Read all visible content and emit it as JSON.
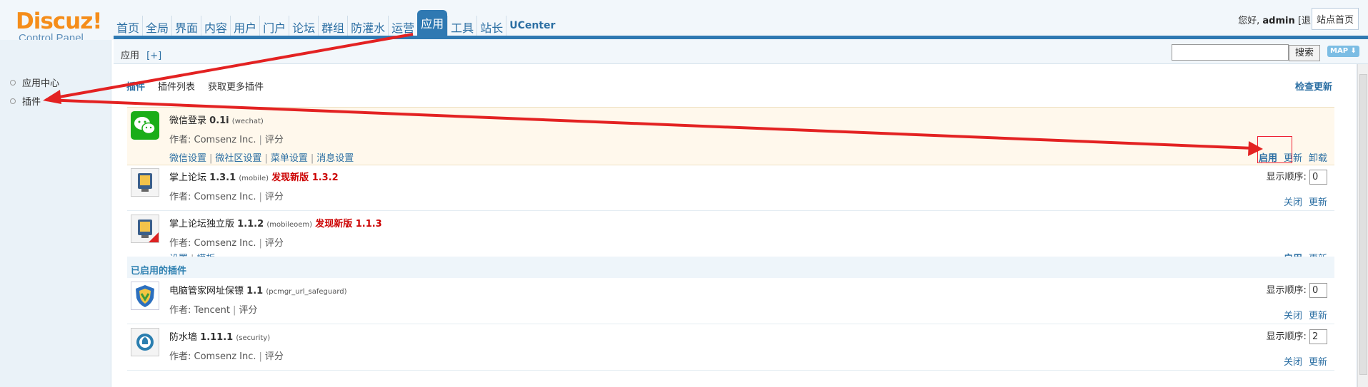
{
  "header": {
    "logo_brand": "Discuz!",
    "logo_sub": "Control Panel",
    "nav": [
      "首页",
      "全局",
      "界面",
      "内容",
      "用户",
      "门户",
      "论坛",
      "群组",
      "防灌水",
      "运营",
      "应用",
      "工具",
      "站长",
      "UCenter"
    ],
    "active_nav": "应用",
    "greeting_prefix": "您好,",
    "user": "admin",
    "logout": "[退出]",
    "site_home": "站点首页"
  },
  "sidebar": {
    "items": [
      {
        "label": "应用中心"
      },
      {
        "label": "插件"
      }
    ]
  },
  "subbar": {
    "crumb": "应用",
    "add": "[+]",
    "search_button": "搜索",
    "map_button": "MAP ⬇"
  },
  "tabs": {
    "items": [
      "插件",
      "插件列表",
      "获取更多插件"
    ],
    "check_update": "检查更新"
  },
  "plugins": [
    {
      "name": "微信登录",
      "version": "0.1i",
      "id": "(wechat)",
      "new_version": "",
      "author": "作者: Comsenz Inc.",
      "rate": "评分",
      "links": [
        "微信设置",
        "微社区设置",
        "菜单设置",
        "消息设置"
      ],
      "actions": [
        "启用",
        "更新",
        "卸载"
      ],
      "icon": "wechat-icon"
    },
    {
      "name": "掌上论坛",
      "version": "1.3.1",
      "id": "(mobile)",
      "new_version": "发现新版 1.3.2",
      "author": "作者: Comsenz Inc.",
      "rate": "评分",
      "order_label": "显示顺序:",
      "order": "0",
      "actions": [
        "关闭",
        "更新"
      ],
      "icon": "mobile-icon"
    },
    {
      "name": "掌上论坛独立版",
      "version": "1.1.2",
      "id": "(mobileoem)",
      "new_version": "发现新版 1.1.3",
      "author": "作者: Comsenz Inc.",
      "rate": "评分",
      "links": [
        "设置",
        "模板"
      ],
      "actions": [
        "启用",
        "更新"
      ],
      "icon": "mobile-oem-icon"
    }
  ],
  "section": {
    "enabled_title": "已启用的插件"
  },
  "enabled_plugins": [
    {
      "name": "电脑管家网址保镖",
      "version": "1.1",
      "id": "(pcmgr_url_safeguard)",
      "author": "作者: Tencent",
      "rate": "评分",
      "order_label": "显示顺序:",
      "order": "0",
      "actions": [
        "关闭",
        "更新"
      ],
      "icon": "shield-icon"
    },
    {
      "name": "防水墙",
      "version": "1.11.1",
      "id": "(security)",
      "author": "作者: Comsenz Inc.",
      "rate": "评分",
      "order_label": "显示顺序:",
      "order": "2",
      "actions": [
        "关闭",
        "更新"
      ],
      "icon": "security-icon"
    }
  ],
  "colors": {
    "accent": "#2f79b2",
    "logo": "#f58d1a",
    "link": "#2c6fa3",
    "new_version": "#cc0000",
    "annotation": "#e32222"
  }
}
